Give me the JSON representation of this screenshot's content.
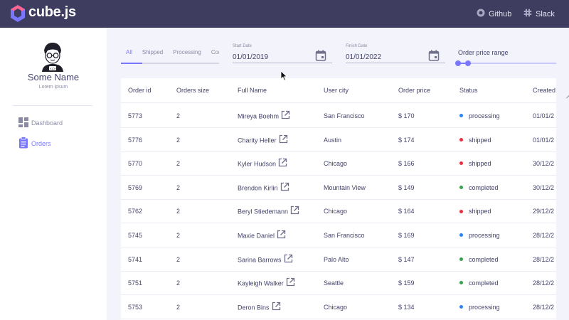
{
  "header": {
    "brand": "cube.js",
    "github_label": "Github",
    "slack_label": "Slack"
  },
  "sidebar": {
    "user_name": "Some Name",
    "user_subtitle": "Lorem ipsum",
    "items": [
      {
        "label": "Dashboard",
        "icon": "dashboard-icon",
        "active": false
      },
      {
        "label": "Orders",
        "icon": "clipboard-icon",
        "active": true
      }
    ]
  },
  "filters": {
    "tabs": [
      "All",
      "Shipped",
      "Processing",
      "Cor"
    ],
    "start_date": {
      "label": "Start Date",
      "value": "01/01/2019"
    },
    "finish_date": {
      "label": "Finish Date",
      "value": "01/01/2022"
    },
    "price_range_label": "Order price range"
  },
  "table": {
    "columns": [
      "Order id",
      "Orders size",
      "Full Name",
      "User city",
      "Order price",
      "Status",
      "Created"
    ],
    "rows": [
      {
        "id": "5773",
        "size": "2",
        "name": "Mireya Boehm",
        "city": "San Francisco",
        "price": "$ 170",
        "status": "processing",
        "created": "01/01/2"
      },
      {
        "id": "5776",
        "size": "2",
        "name": "Charity Heller",
        "city": "Austin",
        "price": "$ 174",
        "status": "shipped",
        "created": "01/01/2"
      },
      {
        "id": "5770",
        "size": "2",
        "name": "Kyler Hudson",
        "city": "Chicago",
        "price": "$ 166",
        "status": "shipped",
        "created": "30/12/2"
      },
      {
        "id": "5769",
        "size": "2",
        "name": "Brendon Kirlin",
        "city": "Mountain View",
        "price": "$ 149",
        "status": "completed",
        "created": "30/12/2"
      },
      {
        "id": "5762",
        "size": "2",
        "name": "Beryl Stiedemann",
        "city": "Chicago",
        "price": "$ 164",
        "status": "shipped",
        "created": "29/12/2"
      },
      {
        "id": "5745",
        "size": "2",
        "name": "Maxie Daniel",
        "city": "San Francisco",
        "price": "$ 169",
        "status": "processing",
        "created": "28/12/2"
      },
      {
        "id": "5741",
        "size": "2",
        "name": "Sarina Barrows",
        "city": "Palo Alto",
        "price": "$ 147",
        "status": "completed",
        "created": "28/12/2"
      },
      {
        "id": "5751",
        "size": "2",
        "name": "Kayleigh Walker",
        "city": "Seattle",
        "price": "$ 159",
        "status": "completed",
        "created": "28/12/2"
      },
      {
        "id": "5753",
        "size": "2",
        "name": "Deron Bins",
        "city": "Chicago",
        "price": "$ 134",
        "status": "processing",
        "created": "28/12/2"
      }
    ]
  },
  "status_colors": {
    "processing": "#2d83f0",
    "shipped": "#e8303f",
    "completed": "#3aa14e"
  },
  "colors": {
    "accent": "#7a77ff",
    "topbar": "#3e3c5f"
  }
}
